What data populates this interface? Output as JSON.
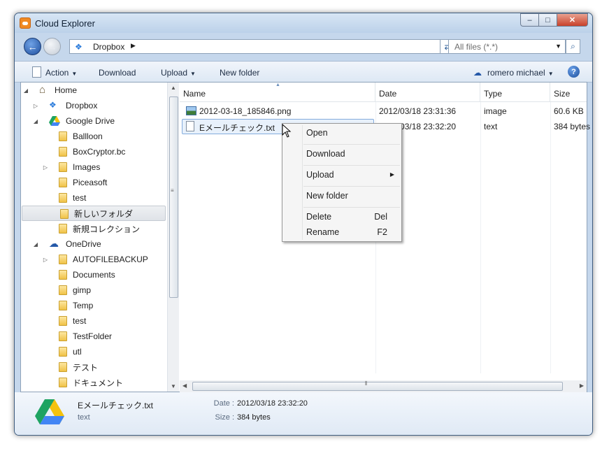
{
  "window": {
    "title": "Cloud Explorer",
    "minimize": "–",
    "maximize": "□",
    "close": "✕"
  },
  "address": {
    "path": "Dropbox",
    "filter": "All files (*.*)"
  },
  "toolbar": {
    "action": "Action",
    "download": "Download",
    "upload": "Upload",
    "new_folder": "New folder",
    "user": "romero michael"
  },
  "tree": [
    {
      "label": "Home",
      "level": 0,
      "expander": "◢",
      "icon": "home-icon"
    },
    {
      "label": "Dropbox",
      "level": 1,
      "expander": "▷",
      "icon": "dropbox-icon"
    },
    {
      "label": "Google Drive",
      "level": 1,
      "expander": "◢",
      "icon": "google-drive-icon"
    },
    {
      "label": "Ballloon",
      "level": 2,
      "expander": "",
      "icon": "folder-icon"
    },
    {
      "label": "BoxCryptor.bc",
      "level": 2,
      "expander": "",
      "icon": "folder-icon"
    },
    {
      "label": "Images",
      "level": 2,
      "expander": "▷",
      "icon": "folder-icon"
    },
    {
      "label": "Piceasoft",
      "level": 2,
      "expander": "",
      "icon": "folder-icon"
    },
    {
      "label": "test",
      "level": 2,
      "expander": "",
      "icon": "folder-icon"
    },
    {
      "label": "新しいフォルダ",
      "level": 2,
      "expander": "",
      "icon": "folder-icon",
      "selected": true
    },
    {
      "label": "新規コレクション",
      "level": 2,
      "expander": "",
      "icon": "folder-icon"
    },
    {
      "label": "OneDrive",
      "level": 1,
      "expander": "◢",
      "icon": "onedrive-icon"
    },
    {
      "label": "AUTOFILEBACKUP",
      "level": 2,
      "expander": "▷",
      "icon": "folder-icon"
    },
    {
      "label": "Documents",
      "level": 2,
      "expander": "",
      "icon": "folder-icon"
    },
    {
      "label": "gimp",
      "level": 2,
      "expander": "",
      "icon": "folder-icon"
    },
    {
      "label": "Temp",
      "level": 2,
      "expander": "",
      "icon": "folder-icon"
    },
    {
      "label": "test",
      "level": 2,
      "expander": "",
      "icon": "folder-icon"
    },
    {
      "label": "TestFolder",
      "level": 2,
      "expander": "",
      "icon": "folder-icon"
    },
    {
      "label": "utl",
      "level": 2,
      "expander": "",
      "icon": "folder-icon"
    },
    {
      "label": "テスト",
      "level": 2,
      "expander": "",
      "icon": "folder-icon"
    },
    {
      "label": "ドキュメント",
      "level": 2,
      "expander": "",
      "icon": "folder-icon"
    }
  ],
  "columns": {
    "name": "Name",
    "date": "Date",
    "type": "Type",
    "size": "Size"
  },
  "files": [
    {
      "name": "2012-03-18_185846.png",
      "date": "2012/03/18 23:31:36",
      "type": "image",
      "size": "60.6 KB",
      "icon": "image-file-icon"
    },
    {
      "name": "Eメールチェック.txt",
      "date": "2012/03/18 23:32:20",
      "type": "text",
      "size": "384 bytes",
      "icon": "text-file-icon",
      "selected": true
    }
  ],
  "context_menu": {
    "open": "Open",
    "download": "Download",
    "upload": "Upload",
    "new_folder": "New folder",
    "delete": "Delete",
    "delete_shortcut": "Del",
    "rename": "Rename",
    "rename_shortcut": "F2"
  },
  "details": {
    "name": "Eメールチェック.txt",
    "type": "text",
    "date_label": "Date :",
    "date_value": "2012/03/18 23:32:20",
    "size_label": "Size :",
    "size_value": "384 bytes"
  },
  "colors": {
    "titlebar": "#c5d7ec",
    "selection": "#e8f1fb",
    "accent": "#2458a8"
  }
}
